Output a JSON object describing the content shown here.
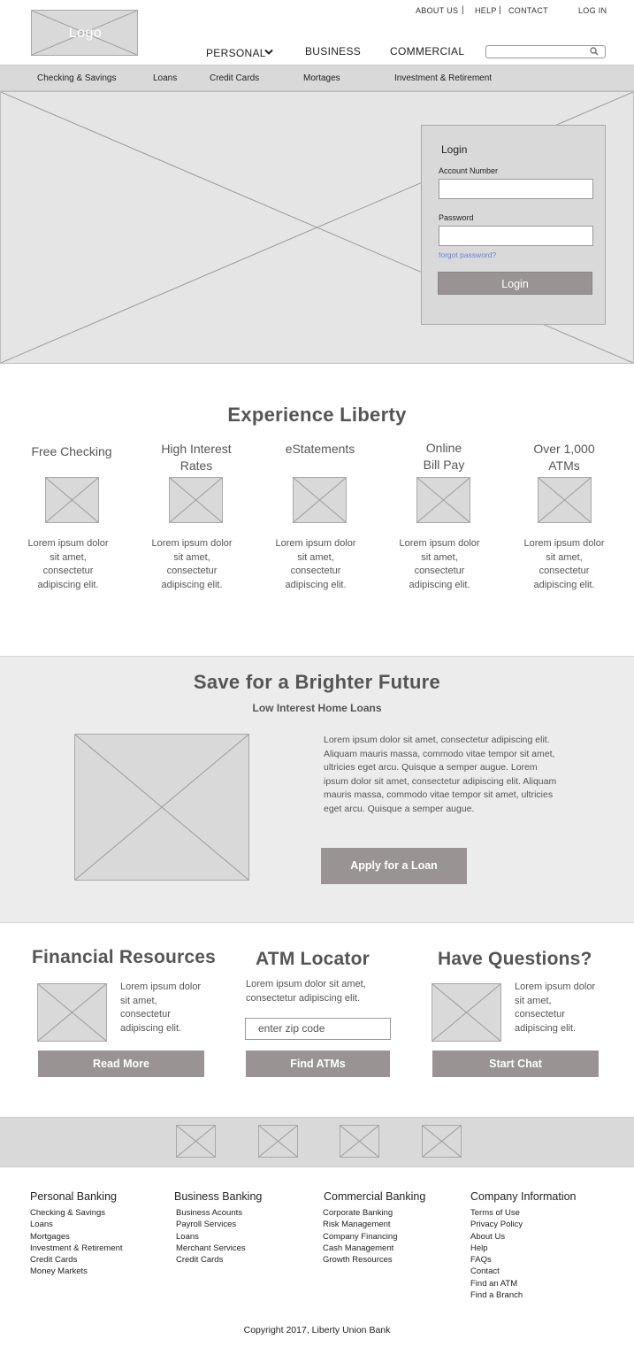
{
  "header": {
    "logo_text": "Logo",
    "top_links": {
      "about": "ABOUT US",
      "help": "HELP",
      "contact": "CONTACT",
      "login": "LOG IN",
      "separator": "|"
    },
    "main_nav": {
      "personal": "PERSONAL",
      "business": "BUSINESS",
      "commercial": "COMMERCIAL"
    },
    "search": {
      "placeholder": "",
      "icon": "search-icon"
    }
  },
  "subnav": {
    "items": [
      "Checking & Savings",
      "Loans",
      "Credit Cards",
      "Mortages",
      "Investment & Retirement"
    ]
  },
  "login": {
    "title": "Login",
    "account_label": "Account Number",
    "account_value": "",
    "password_label": "Password",
    "password_value": "",
    "forgot": "forgot password?",
    "button": "Login"
  },
  "experience": {
    "title": "Experience Liberty",
    "features": [
      {
        "title_line1": "Free Checking",
        "title_line2": "",
        "body": [
          "Lorem ipsum dolor",
          "sit amet,",
          "consectetur",
          "adipiscing elit."
        ]
      },
      {
        "title_line1": "High Interest",
        "title_line2": "Rates",
        "body": [
          "Lorem ipsum dolor",
          "sit amet,",
          "consectetur",
          "adipiscing elit."
        ]
      },
      {
        "title_line1": "eStatements",
        "title_line2": "",
        "body": [
          "Lorem ipsum dolor",
          "sit amet,",
          "consectetur",
          "adipiscing elit."
        ]
      },
      {
        "title_line1": "Online",
        "title_line2": "Bill Pay",
        "body": [
          "Lorem ipsum dolor",
          "sit amet,",
          "consectetur",
          "adipiscing elit."
        ]
      },
      {
        "title_line1": "Over 1,000",
        "title_line2": "ATMs",
        "body": [
          "Lorem ipsum dolor",
          "sit amet,",
          "consectetur",
          "adipiscing elit."
        ]
      }
    ]
  },
  "save": {
    "title": "Save for a Brighter Future",
    "subtitle": "Low Interest Home Loans",
    "text": "Lorem ipsum dolor sit amet, consectetur adipiscing elit. Aliquam mauris massa, commodo vitae tempor sit amet, ultricies eget arcu. Quisque a semper augue.  Lorem ipsum dolor sit amet, consectetur adipiscing elit. Aliquam mauris massa, commodo vitae tempor sit amet, ultricies eget arcu. Quisque a semper augue.",
    "button": "Apply for a Loan"
  },
  "resources": {
    "financial": {
      "title": "Financial Resources",
      "text": [
        "Lorem ipsum dolor",
        "sit amet,",
        "consectetur",
        "adipiscing elit."
      ],
      "button": "Read More"
    },
    "atm": {
      "title": "ATM Locator",
      "text": [
        "Lorem ipsum dolor sit amet,",
        "consectetur adipiscing elit."
      ],
      "zip_placeholder": "enter zip code",
      "button": "Find ATMs"
    },
    "questions": {
      "title": "Have Questions?",
      "text": [
        "Lorem ipsum dolor",
        "sit amet,",
        "consectetur",
        "adipiscing elit."
      ],
      "button": "Start Chat"
    }
  },
  "footer": {
    "columns": [
      {
        "heading": "Personal Banking",
        "links": [
          "Checking & Savings",
          "Loans",
          "Mortgages",
          "Investment & Retirement",
          "Credit Cards",
          "Money Markets"
        ]
      },
      {
        "heading": "Business Banking",
        "links": [
          "Business Acounts",
          "Payroll Services",
          "Loans",
          "Merchant Services",
          "Credit Cards"
        ]
      },
      {
        "heading": "Commercial Banking",
        "links": [
          "Corporate Banking",
          "Risk Management",
          "Company Financing",
          "Cash Management",
          "Growth Resources"
        ]
      },
      {
        "heading": "Company Information",
        "links": [
          "Terms of Use",
          "Privacy Policy",
          "About Us",
          "Help",
          "FAQs",
          "Contact",
          "Find an ATM",
          "Find a Branch"
        ]
      }
    ],
    "copyright": "Copyright 2017, Liberty Union Bank"
  },
  "colors": {
    "button_gray": "#999393",
    "band_gray": "#d9d9d9",
    "link_blue": "#6f7de0"
  }
}
